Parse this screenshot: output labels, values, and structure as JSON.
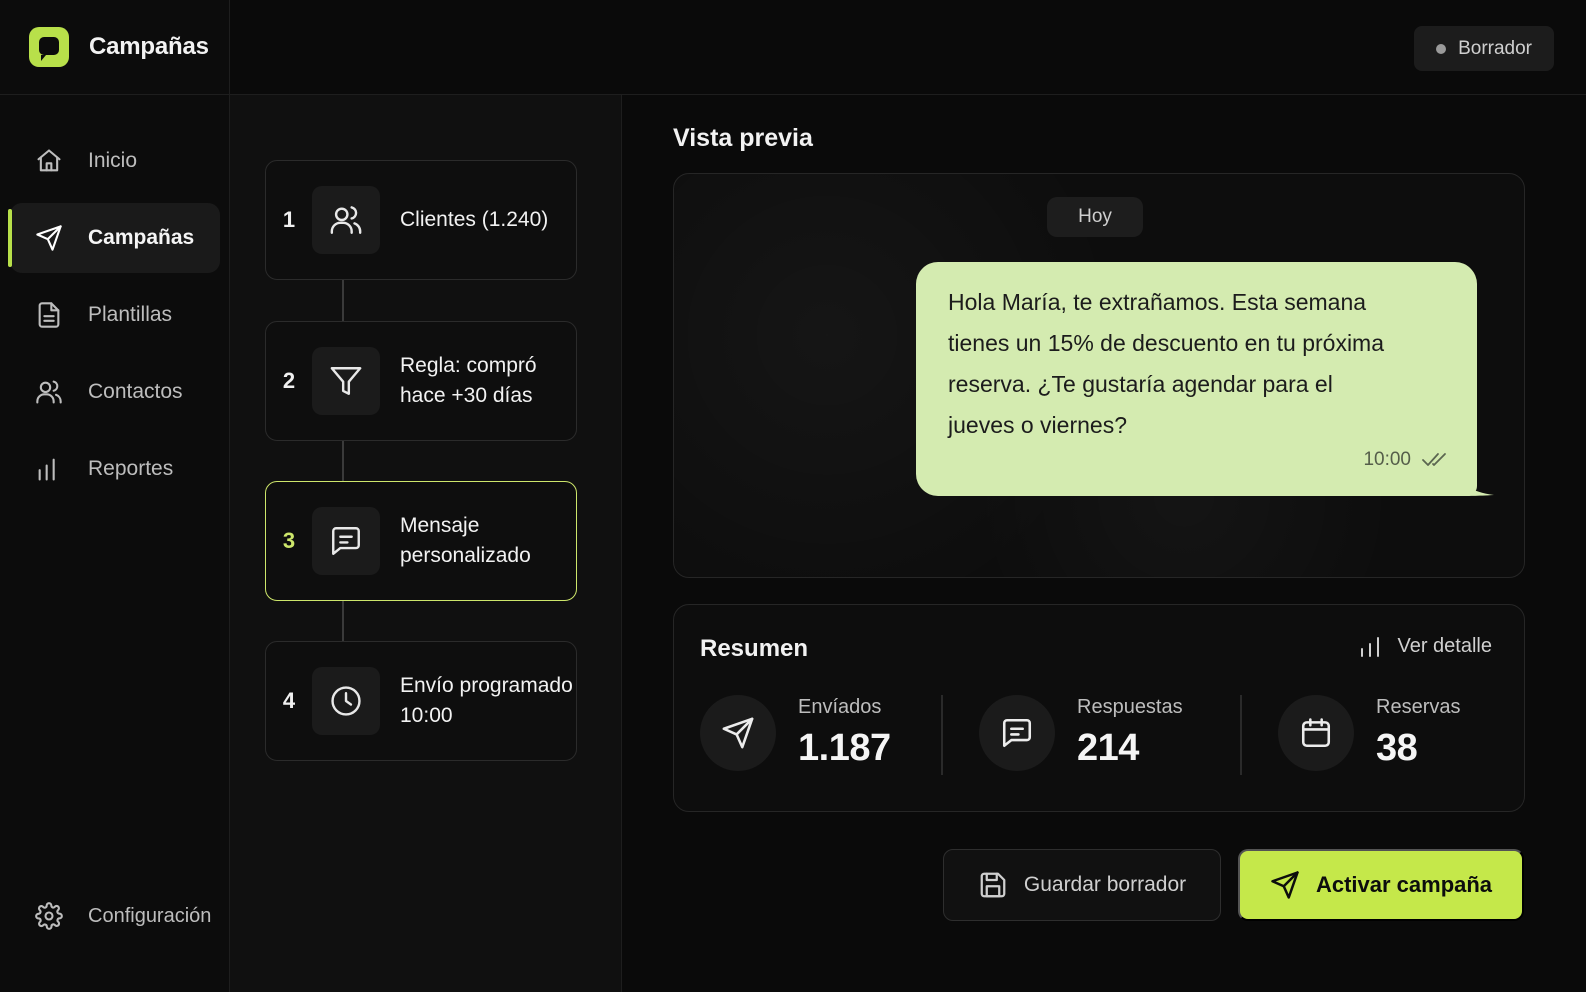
{
  "app": {
    "title": "Campañas",
    "logo_icon": "chat-bubble-icon",
    "accent_color": "#c5e84a"
  },
  "sidebar": {
    "items": [
      {
        "label": "Inicio",
        "icon": "home-icon",
        "active": false
      },
      {
        "label": "Campañas",
        "icon": "send-icon",
        "active": true
      },
      {
        "label": "Plantillas",
        "icon": "document-icon",
        "active": false
      },
      {
        "label": "Contactos",
        "icon": "users-icon",
        "active": false
      },
      {
        "label": "Reportes",
        "icon": "bar-chart-icon",
        "active": false
      }
    ],
    "settings_label": "Configuración"
  },
  "topbar": {
    "status_label": "Borrador"
  },
  "steps": [
    {
      "number": "1",
      "icon": "users-icon",
      "line1": "Clientes (1.240)",
      "line2": ""
    },
    {
      "number": "2",
      "icon": "filter-icon",
      "line1": "Regla: compró",
      "line2": "hace +30 días"
    },
    {
      "number": "3",
      "icon": "message-icon",
      "line1": "Mensaje",
      "line2": "personalizado",
      "active": true
    },
    {
      "number": "4",
      "icon": "clock-icon",
      "line1": "Envío programado",
      "line2": "10:00"
    }
  ],
  "preview": {
    "title": "Vista previa",
    "day_label": "Hoy",
    "message_lines": [
      "Hola María, te extrañamos. Esta semana",
      "tienes un 15% de descuento en tu próxima",
      "reserva. ¿Te gustaría agendar para el",
      "jueves o viernes?"
    ],
    "time": "10:00",
    "bubble_color": "#d4ebb0"
  },
  "summary": {
    "title": "Resumen",
    "detail_label": "Ver detalle",
    "stats": [
      {
        "label": "Envíados",
        "value": "1.187",
        "icon": "send-icon"
      },
      {
        "label": "Respuestas",
        "value": "214",
        "icon": "message-icon"
      },
      {
        "label": "Reservas",
        "value": "38",
        "icon": "calendar-icon"
      }
    ]
  },
  "actions": {
    "save_label": "Guardar borrador",
    "activate_label": "Activar campaña"
  }
}
